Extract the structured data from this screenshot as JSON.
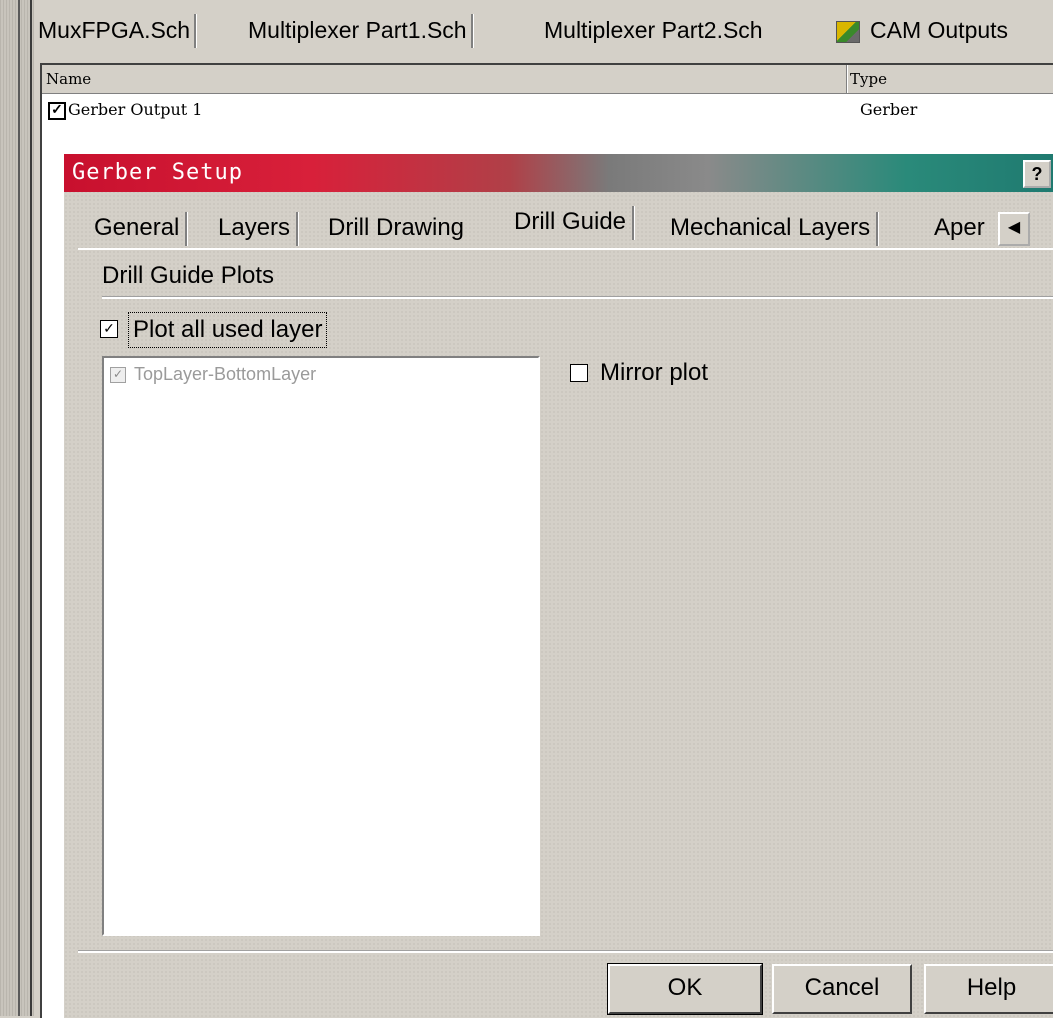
{
  "doc_tabs": [
    "MuxFPGA.Sch",
    "Multiplexer Part1.Sch",
    "Multiplexer Part2.Sch",
    "CAM Outputs"
  ],
  "list": {
    "col_name": "Name",
    "col_type": "Type",
    "rows": [
      {
        "checked": true,
        "name": "Gerber Output 1",
        "type": "Gerber"
      }
    ]
  },
  "dialog": {
    "title": "Gerber Setup",
    "help": "?",
    "tabs": [
      "General",
      "Layers",
      "Drill Drawing",
      "Drill Guide",
      "Mechanical Layers",
      "Aper"
    ],
    "active_tab": "Drill Guide",
    "group_title": "Drill Guide Plots",
    "plot_all_label": "Plot all used layer",
    "plot_all_checked": true,
    "layer_items": [
      {
        "label": "TopLayer-BottomLayer",
        "checked": true,
        "disabled": true
      }
    ],
    "mirror_label": "Mirror plot",
    "mirror_checked": false,
    "buttons": {
      "ok": "OK",
      "cancel": "Cancel",
      "help": "Help"
    }
  },
  "colors": {
    "title_red": "#c8102e",
    "title_teal": "#1f7a70",
    "face": "#d4d0c8"
  }
}
